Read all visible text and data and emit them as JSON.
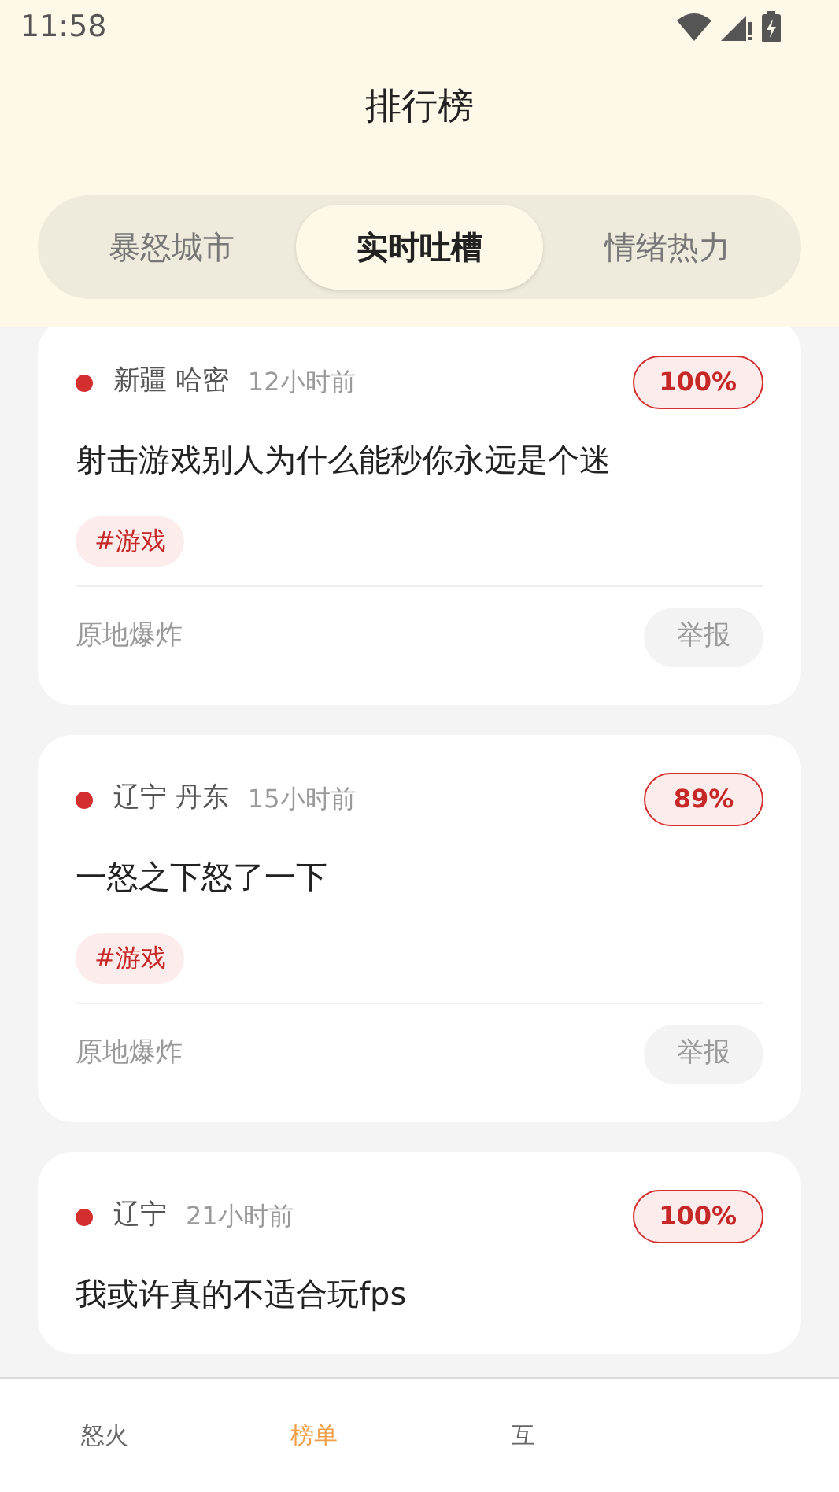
{
  "status_bar": {
    "time": "11:58"
  },
  "title": "排行榜",
  "tabs": [
    {
      "label": "暴怒城市",
      "selected": false
    },
    {
      "label": "实时吐槽",
      "selected": true
    },
    {
      "label": "情绪热力",
      "selected": false
    }
  ],
  "posts": [
    {
      "location": "新疆 哈密",
      "time": "12小时前",
      "percent": "100%",
      "text": "射击游戏别人为什么能秒你永远是个迷",
      "tag": "#游戏",
      "reaction": "原地爆炸",
      "report": "举报"
    },
    {
      "location": "辽宁 丹东",
      "time": "15小时前",
      "percent": "89%",
      "text": "一怒之下怒了一下",
      "tag": "#游戏",
      "reaction": "原地爆炸",
      "report": "举报"
    },
    {
      "location": "辽宁",
      "time": "21小时前",
      "percent": "100%",
      "text": "我或许真的不适合玩fps"
    }
  ],
  "bottom_nav": [
    {
      "label": "怒火",
      "selected": false
    },
    {
      "label": "榜单",
      "selected": true
    },
    {
      "label": "互",
      "selected": false
    }
  ]
}
